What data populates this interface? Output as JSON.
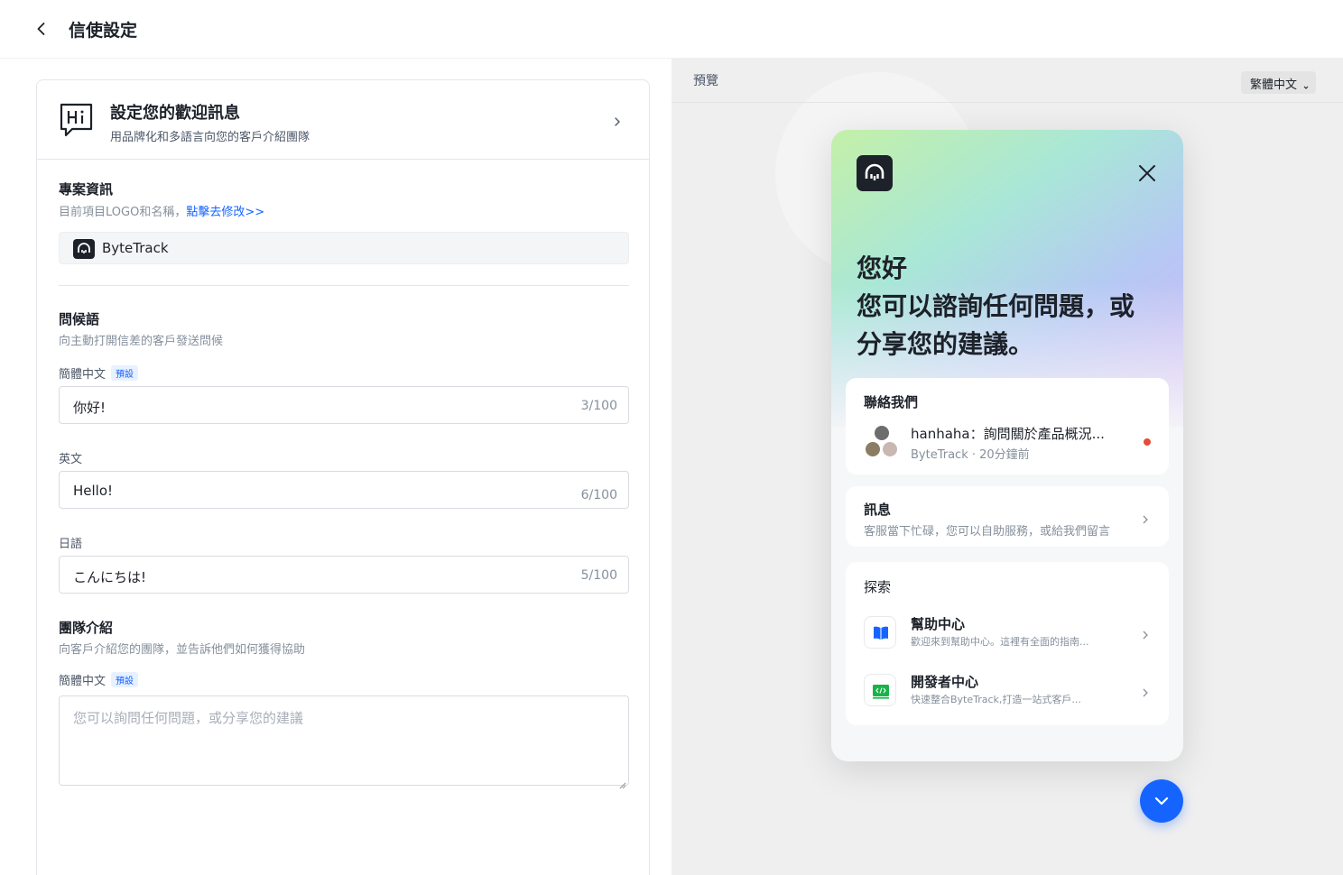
{
  "header": {
    "title": "信使設定"
  },
  "welcome": {
    "title": "設定您的歡迎訊息",
    "subtitle": "用品牌化和多語言向您的客戶介紹團隊"
  },
  "project": {
    "title": "專案資訊",
    "subtitle": "目前項目LOGO和名稱，",
    "link": "點擊去修改>>",
    "name": "ByteTrack"
  },
  "greeting_section": {
    "title": "問候語",
    "subtitle": "向主動打開信差的客戶發送問候",
    "fields": [
      {
        "label": "簡體中文",
        "tag": "預設",
        "value": "你好!",
        "count": "3/100"
      },
      {
        "label": "英文",
        "value": "Hello!",
        "count": "6/100"
      },
      {
        "label": "日語",
        "value": "こんにちは!",
        "count": "5/100"
      }
    ]
  },
  "team_section": {
    "title": "團隊介紹",
    "subtitle": "向客戶介紹您的團隊，並告訴他們如何獲得協助",
    "field_label": "簡體中文",
    "tag": "預設",
    "placeholder": "您可以詢問任何問題，或分享您的建議"
  },
  "preview": {
    "label": "預覽",
    "language": "繁體中文",
    "widget": {
      "greeting_line1": "您好",
      "greeting_line2": "您可以諮詢任何問題，或",
      "greeting_line3": "分享您的建議。",
      "contact": {
        "title": "聯絡我們",
        "main": "hanhaha：詢問關於產品概況...",
        "meta": "ByteTrack · 20分鐘前"
      },
      "message": {
        "title": "訊息",
        "subtitle": "客服當下忙碌，您可以自助服務，或給我們留言"
      },
      "explore": {
        "title": "探索",
        "items": [
          {
            "title": "幫助中心",
            "subtitle": "歡迎來到幫助中心。這裡有全面的指南...",
            "icon": "book-icon"
          },
          {
            "title": "開發者中心",
            "subtitle": "快速整合ByteTrack,打造一站式客戶...",
            "icon": "code-icon"
          }
        ]
      }
    }
  },
  "colors": {
    "accent": "#1664ff",
    "unread": "#e34d3a"
  }
}
